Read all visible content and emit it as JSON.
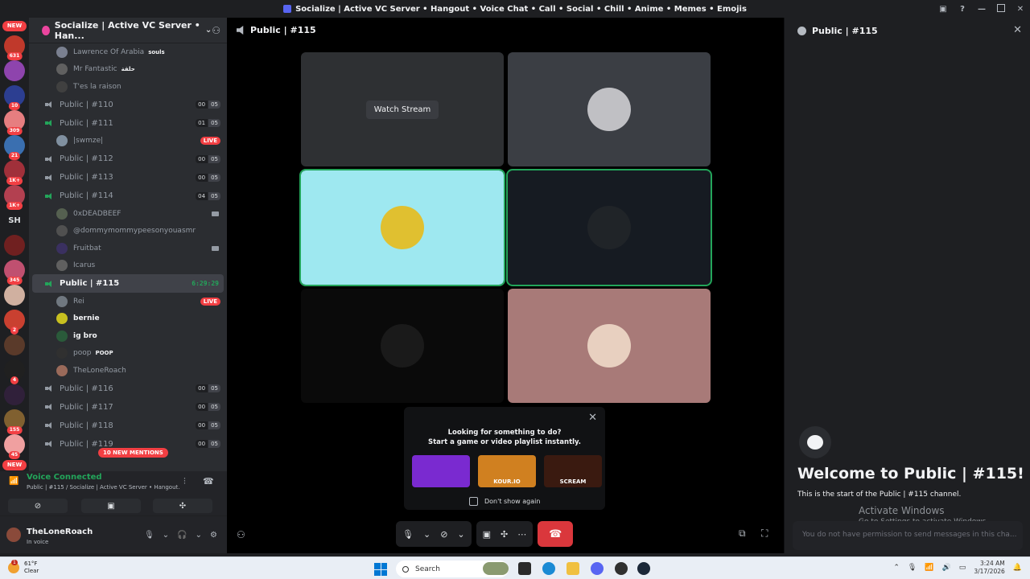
{
  "window": {
    "title": "Socialize | Active VC Server • Hangout • Voice Chat • Call • Social • Chill • Anime • Memes • Emojis"
  },
  "guilds": {
    "new_label": "NEW",
    "items": [
      {
        "color": "#c0392b",
        "badge": "631"
      },
      {
        "color": "#8e44ad",
        "badge": ""
      },
      {
        "color": "#2c3e91",
        "badge": "10"
      },
      {
        "color": "#e67e80",
        "badge": "309"
      },
      {
        "color": "#3a6fb0",
        "badge": "21"
      },
      {
        "color": "#a0303a",
        "badge": "1K+"
      },
      {
        "color": "#b34050",
        "badge": "1K+"
      }
    ],
    "text_server": "SH",
    "items2": [
      {
        "color": "#702020",
        "badge": ""
      },
      {
        "color": "#c05070",
        "badge": "345"
      },
      {
        "color": "#d0b0a0",
        "badge": ""
      },
      {
        "color": "#c94030",
        "badge": "2"
      },
      {
        "color": "#5a3a2a",
        "badge": ""
      },
      {
        "color": "#202020",
        "badge": "4"
      },
      {
        "color": "#30203a",
        "badge": ""
      },
      {
        "color": "#806030",
        "badge": "155"
      },
      {
        "color": "#f0a0a0",
        "badge": "45"
      }
    ],
    "new_bottom": "NEW"
  },
  "server": {
    "name": "Socialize | Active VC Server • Han..."
  },
  "channels": {
    "top_members": [
      {
        "name": "Lawrence Of Arabia",
        "tag": "souls",
        "color": "#7a8090"
      },
      {
        "name": "Mr Fantastic",
        "tag": "حلقة",
        "color": "#606060"
      },
      {
        "name": "T'es la raison",
        "tag": "",
        "color": "#404040"
      }
    ],
    "c110": {
      "name": "Public | #110",
      "a": "00",
      "b": "05"
    },
    "c111": {
      "name": "Public | #111",
      "a": "01",
      "b": "05"
    },
    "c111_member": {
      "name": "|swmze|",
      "live": "LIVE"
    },
    "c112": {
      "name": "Public | #112",
      "a": "00",
      "b": "05"
    },
    "c113": {
      "name": "Public | #113",
      "a": "00",
      "b": "05"
    },
    "c114": {
      "name": "Public | #114",
      "a": "04",
      "b": "05"
    },
    "c114_members": [
      {
        "name": "0xDEADBEEF",
        "color": "#556050"
      },
      {
        "name": "@dommymommypeesonyouasmr",
        "color": "#505050"
      },
      {
        "name": "Fruitbat",
        "color": "#3a3060"
      },
      {
        "name": "Icarus",
        "color": "#606060"
      }
    ],
    "c115": {
      "name": "Public | #115",
      "timer": "6:29:29"
    },
    "c115_members": [
      {
        "name": "Rei",
        "color": "#707880"
      },
      {
        "name": "bernie",
        "color": "#c8c020"
      },
      {
        "name": "ig bro",
        "color": "#2a5a3a"
      },
      {
        "name": "poop",
        "tag": "POOP",
        "color": "#303030"
      },
      {
        "name": "TheLoneRoach",
        "color": "#9a6a5a"
      }
    ],
    "c115_live": "LIVE",
    "c116": {
      "name": "Public | #116",
      "a": "00",
      "b": "05"
    },
    "c117": {
      "name": "Public | #117",
      "a": "00",
      "b": "05"
    },
    "c118": {
      "name": "Public | #118",
      "a": "00",
      "b": "05"
    },
    "c119": {
      "name": "Public | #119",
      "a": "00",
      "b": "05"
    },
    "mentions": "10 NEW MENTIONS"
  },
  "voice": {
    "status": "Voice Connected",
    "sub": "Public | #115 / Socialize | Active VC Server • Hangout..."
  },
  "user": {
    "name": "TheLoneRoach",
    "status": "In voice"
  },
  "call": {
    "title": "Public | #115",
    "watch": "Watch Stream",
    "tiles": [
      {
        "bg": "#2e3033",
        "avatar": ""
      },
      {
        "bg": "#3b3e44",
        "avatar": "#c0c0c4"
      },
      {
        "bg": "#9ee8f0",
        "avatar": "#e0c030"
      },
      {
        "bg": "#161b22",
        "avatar": "#202428"
      },
      {
        "bg": "#0a0a0a",
        "avatar": "#1a1a1a"
      },
      {
        "bg": "#a87a78",
        "avatar": "#e8d0c0"
      }
    ],
    "activity": {
      "line1": "Looking for something to do?",
      "line2": "Start a game or video playlist instantly.",
      "games": [
        {
          "label": "",
          "color": "#7a2ad0"
        },
        {
          "label": "KOUR.IO",
          "color": "#d08020"
        },
        {
          "label": "SCREAM",
          "color": "#3a1a10"
        }
      ],
      "dont_show": "Don't show again"
    }
  },
  "chat": {
    "header": "Public | #115",
    "welcome": "Welcome to Public | #115!",
    "sub": "This is the start of the Public | #115 channel.",
    "activate1": "Activate Windows",
    "activate2": "Go to Settings to activate Windows.",
    "placeholder": "You do not have permission to send messages in this cha..."
  },
  "taskbar": {
    "weather_badge": "1",
    "temp": "61°F",
    "cond": "Clear",
    "search": "Search",
    "time": "3:24 AM",
    "date": "3/17/2026"
  }
}
